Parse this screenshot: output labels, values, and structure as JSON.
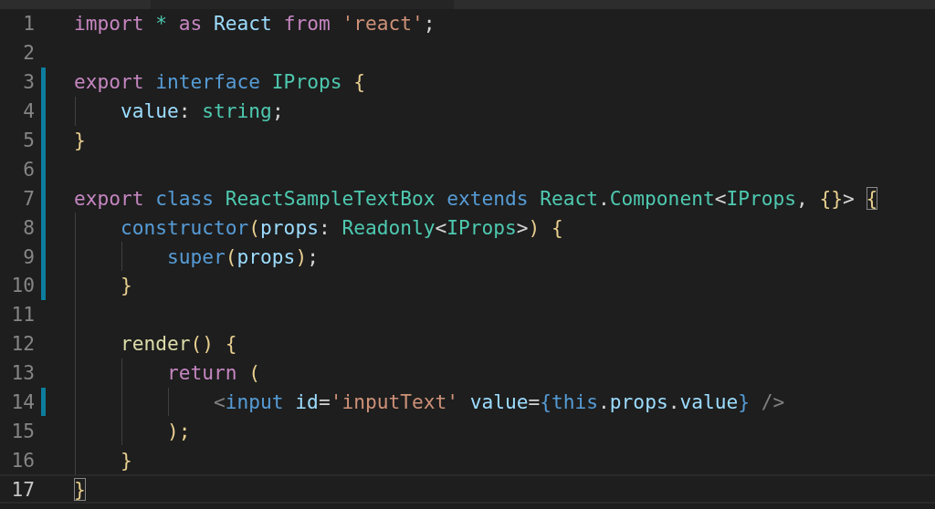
{
  "lines": [
    {
      "number": "1",
      "modified": false,
      "current": false,
      "tokens": [
        {
          "text": "import",
          "kind": "keyword"
        },
        {
          "text": " *",
          "kind": "type"
        },
        {
          "text": " as",
          "kind": "keyword"
        },
        {
          "text": " React",
          "kind": "variable"
        },
        {
          "text": " from",
          "kind": "keyword"
        },
        {
          "text": " 'react'",
          "kind": "string"
        },
        {
          "text": ";",
          "kind": "plain"
        }
      ]
    },
    {
      "number": "2",
      "modified": false,
      "current": false
    },
    {
      "number": "3",
      "modified": true,
      "current": false,
      "tokens": [
        {
          "text": "export",
          "kind": "keyword"
        },
        {
          "text": " interface",
          "kind": "storage"
        },
        {
          "text": " IProps",
          "kind": "type"
        },
        {
          "text": " {",
          "kind": "brace"
        }
      ]
    },
    {
      "number": "4",
      "modified": true,
      "current": false,
      "tokens": [
        {
          "text": "    value",
          "kind": "variable"
        },
        {
          "text": ":",
          "kind": "plain"
        },
        {
          "text": " string",
          "kind": "type"
        },
        {
          "text": ";",
          "kind": "plain"
        }
      ]
    },
    {
      "number": "5",
      "modified": true,
      "current": false,
      "tokens": [
        {
          "text": "}",
          "kind": "brace"
        }
      ]
    },
    {
      "number": "6",
      "modified": true,
      "current": false
    },
    {
      "number": "7",
      "modified": true,
      "current": false,
      "tokens": [
        {
          "text": "export",
          "kind": "keyword"
        },
        {
          "text": " class",
          "kind": "storage"
        },
        {
          "text": " ReactSampleTextBox",
          "kind": "type"
        },
        {
          "text": " extends",
          "kind": "storage"
        },
        {
          "text": " React",
          "kind": "type"
        },
        {
          "text": ".",
          "kind": "plain"
        },
        {
          "text": "Component",
          "kind": "type"
        },
        {
          "text": "<",
          "kind": "plain"
        },
        {
          "text": "IProps",
          "kind": "type"
        },
        {
          "text": ",",
          "kind": "plain"
        },
        {
          "text": " {}",
          "kind": "brace"
        },
        {
          "text": ">",
          "kind": "plain"
        },
        {
          "text": " {",
          "kind": "matched_brace"
        }
      ]
    },
    {
      "number": "8",
      "modified": true,
      "current": false,
      "tokens": [
        {
          "text": "    constructor",
          "kind": "storage"
        },
        {
          "text": "(",
          "kind": "brace"
        },
        {
          "text": "props",
          "kind": "variable"
        },
        {
          "text": ":",
          "kind": "plain"
        },
        {
          "text": " Readonly",
          "kind": "type"
        },
        {
          "text": "<",
          "kind": "plain"
        },
        {
          "text": "IProps",
          "kind": "type"
        },
        {
          "text": ">",
          "kind": "plain"
        },
        {
          "text": ")",
          "kind": "brace"
        },
        {
          "text": " {",
          "kind": "brace"
        }
      ]
    },
    {
      "number": "9",
      "modified": true,
      "current": false,
      "tokens": [
        {
          "text": "        super",
          "kind": "storage"
        },
        {
          "text": "(",
          "kind": "brace"
        },
        {
          "text": "props",
          "kind": "variable"
        },
        {
          "text": ")",
          "kind": "brace"
        },
        {
          "text": ";",
          "kind": "plain"
        }
      ]
    },
    {
      "number": "10",
      "modified": true,
      "current": false,
      "tokens": [
        {
          "text": "    }",
          "kind": "brace"
        }
      ]
    },
    {
      "number": "11",
      "modified": false,
      "current": false
    },
    {
      "number": "12",
      "modified": false,
      "current": false,
      "tokens": [
        {
          "text": "    render",
          "kind": "function"
        },
        {
          "text": "()",
          "kind": "brace"
        },
        {
          "text": " {",
          "kind": "brace"
        }
      ]
    },
    {
      "number": "13",
      "modified": false,
      "current": false,
      "tokens": [
        {
          "text": "        return",
          "kind": "keyword"
        },
        {
          "text": " (",
          "kind": "brace"
        }
      ]
    },
    {
      "number": "14",
      "modified": true,
      "current": false,
      "tokens": [
        {
          "text": "            <",
          "kind": "tag"
        },
        {
          "text": "input",
          "kind": "storage"
        },
        {
          "text": " id",
          "kind": "variable"
        },
        {
          "text": "=",
          "kind": "plain"
        },
        {
          "text": "'inputText'",
          "kind": "string"
        },
        {
          "text": " value",
          "kind": "variable"
        },
        {
          "text": "=",
          "kind": "plain"
        },
        {
          "text": "{",
          "kind": "storage"
        },
        {
          "text": "this",
          "kind": "storage"
        },
        {
          "text": ".",
          "kind": "plain"
        },
        {
          "text": "props",
          "kind": "variable"
        },
        {
          "text": ".",
          "kind": "plain"
        },
        {
          "text": "value",
          "kind": "variable"
        },
        {
          "text": "}",
          "kind": "storage"
        },
        {
          "text": " />",
          "kind": "tag"
        }
      ]
    },
    {
      "number": "15",
      "modified": false,
      "current": false,
      "tokens": [
        {
          "text": "        );",
          "kind": "brace"
        }
      ]
    },
    {
      "number": "16",
      "modified": false,
      "current": false,
      "tokens": [
        {
          "text": "    }",
          "kind": "brace"
        }
      ]
    },
    {
      "number": "17",
      "modified": false,
      "current": true,
      "tokens": [
        {
          "text": "}",
          "kind": "matched_brace"
        }
      ]
    }
  ]
}
